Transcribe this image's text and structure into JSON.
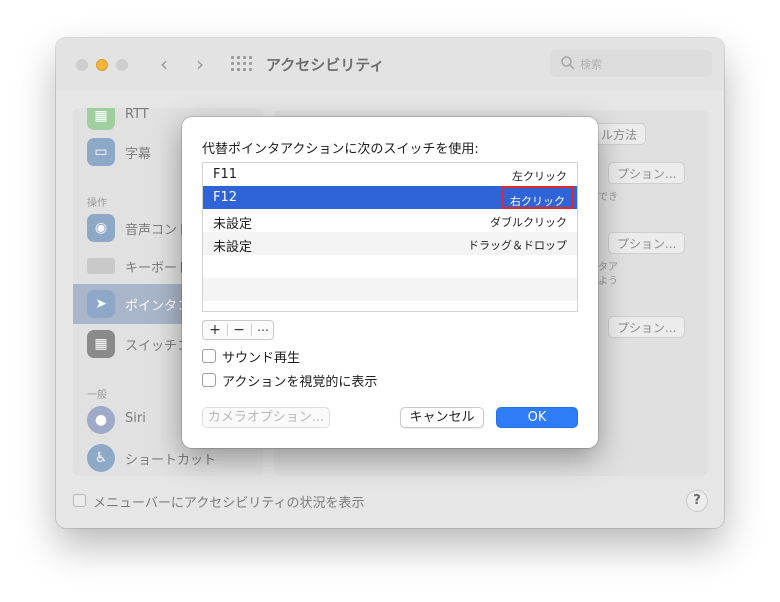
{
  "window": {
    "title": "アクセシビリティ",
    "search_placeholder": "検索"
  },
  "sidebar": {
    "items": [
      {
        "label": "RTT"
      },
      {
        "label": "字幕"
      },
      {
        "label": "音声コント"
      },
      {
        "label": "キーボード"
      },
      {
        "label": "ポインタコ"
      },
      {
        "label": "スイッチコ"
      },
      {
        "label": "Siri"
      },
      {
        "label": "ショートカット"
      }
    ],
    "headers": {
      "operation": "操作",
      "general": "一般"
    }
  },
  "background": {
    "btn1": "ル方法",
    "btn2": "プション...",
    "btn3": "プション...",
    "btn4": "プション...",
    "text1": "でき",
    "text2": "タア",
    "text3": "よう"
  },
  "footer": {
    "menubar_label": "メニューバーにアクセシビリティの状況を表示",
    "help": "?"
  },
  "dialog": {
    "title": "代替ポインタアクションに次のスイッチを使用:",
    "rows": [
      {
        "key": "F11",
        "action": "左クリック"
      },
      {
        "key": "F12",
        "action": "右クリック"
      },
      {
        "key": "未設定",
        "action": "ダブルクリック"
      },
      {
        "key": "未設定",
        "action": "ドラッグ＆ドロップ"
      }
    ],
    "add": "+",
    "remove": "−",
    "more": "⋯",
    "sound_label": "サウンド再生",
    "visual_label": "アクションを視覚的に表示",
    "camera_button": "カメラオプション...",
    "cancel_button": "キャンセル",
    "ok_button": "OK"
  },
  "colors": {
    "selection": "#2f63d8",
    "highlight_border": "#e3262a",
    "ok_button": "#2e7cf6"
  }
}
